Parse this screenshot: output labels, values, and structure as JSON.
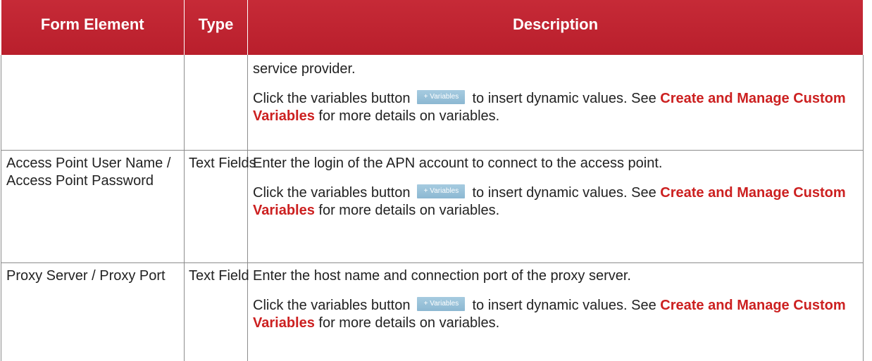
{
  "header": {
    "col1": "Form Element",
    "col2": "Type",
    "col3": "Description"
  },
  "common": {
    "click_prefix": "Click the variables button",
    "variables_button": "+ Variables",
    "click_suffix": "to insert dynamic values. See",
    "link_text": "Create and Manage Custom Variables",
    "link_suffix": "for more details on variables."
  },
  "rows": [
    {
      "element": "",
      "type": "",
      "description": "service provider."
    },
    {
      "element": "Access Point User Name / Access Point Password",
      "type": "Text Fields",
      "description": "Enter the login of the APN account to connect to the access point."
    },
    {
      "element": "Proxy Server / Proxy Port",
      "type": "Text Field",
      "description": "Enter the host name and connection port of the proxy server."
    }
  ]
}
